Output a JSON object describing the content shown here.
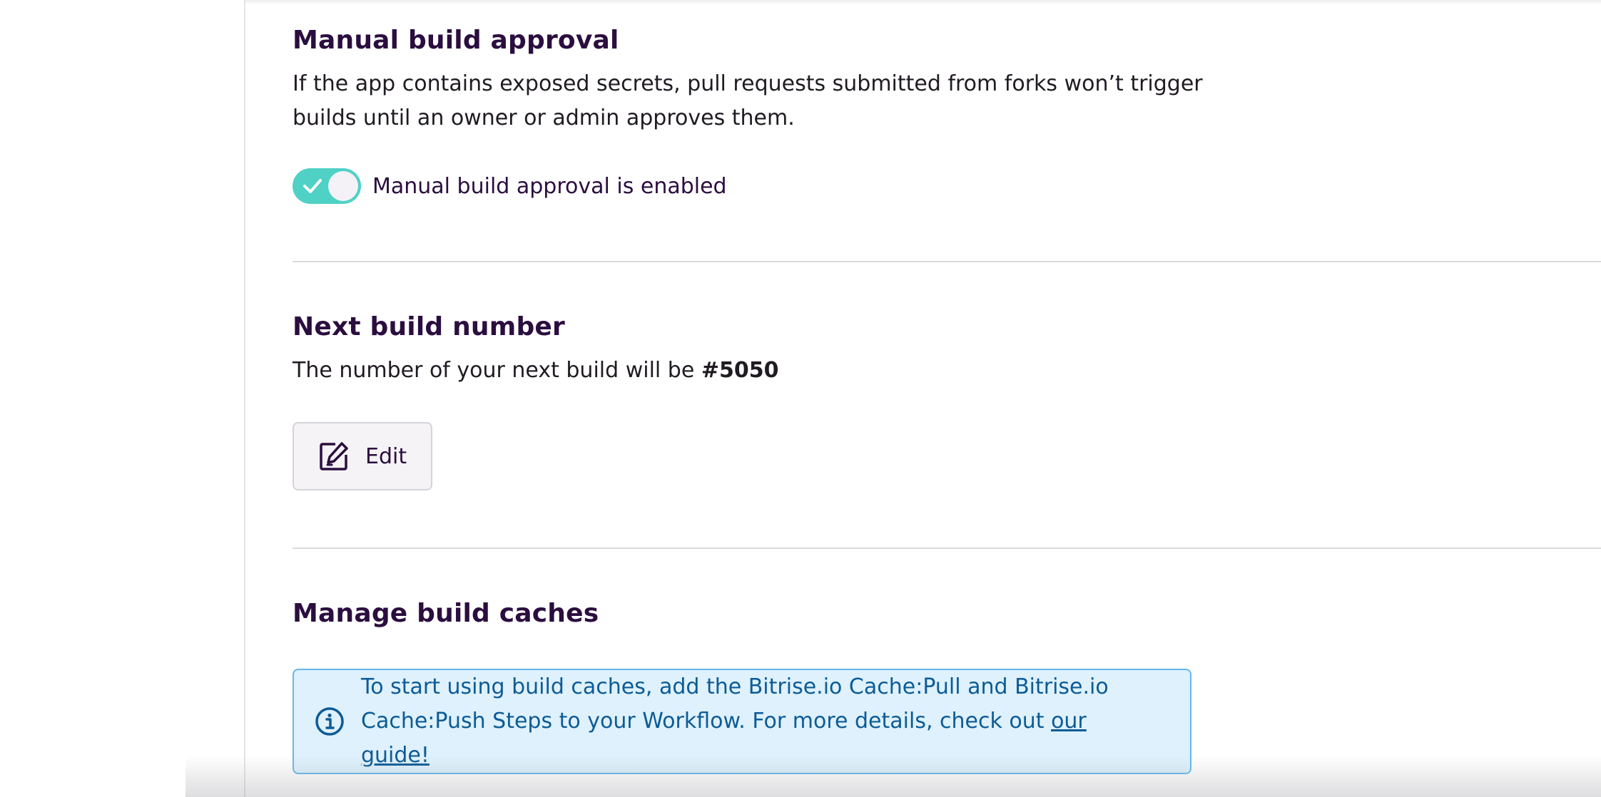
{
  "manual_approval": {
    "title": "Manual build approval",
    "description": "If the app contains exposed secrets, pull requests submitted from forks won’t trigger builds until an owner or admin approves them.",
    "toggle_enabled": true,
    "toggle_label": "Manual build approval is enabled"
  },
  "next_build": {
    "title": "Next build number",
    "description_prefix": "The number of your next build will be ",
    "build_number": "#5050",
    "edit_button_label": "Edit",
    "edit_icon": "edit-icon"
  },
  "build_caches": {
    "title": "Manage build caches",
    "notice_icon": "info-icon",
    "notice_text": "To start using build caches, add the Bitrise.io Cache:Pull and Bitrise.io Cache:Push Steps to your Workflow. For more details, check out ",
    "notice_link": "our guide!"
  },
  "colors": {
    "heading": "#2b0e3f",
    "toggle_on": "#4fd1c5",
    "notice_bg": "#def1fc",
    "notice_border": "#65b8eb",
    "notice_text": "#0d5b96"
  }
}
